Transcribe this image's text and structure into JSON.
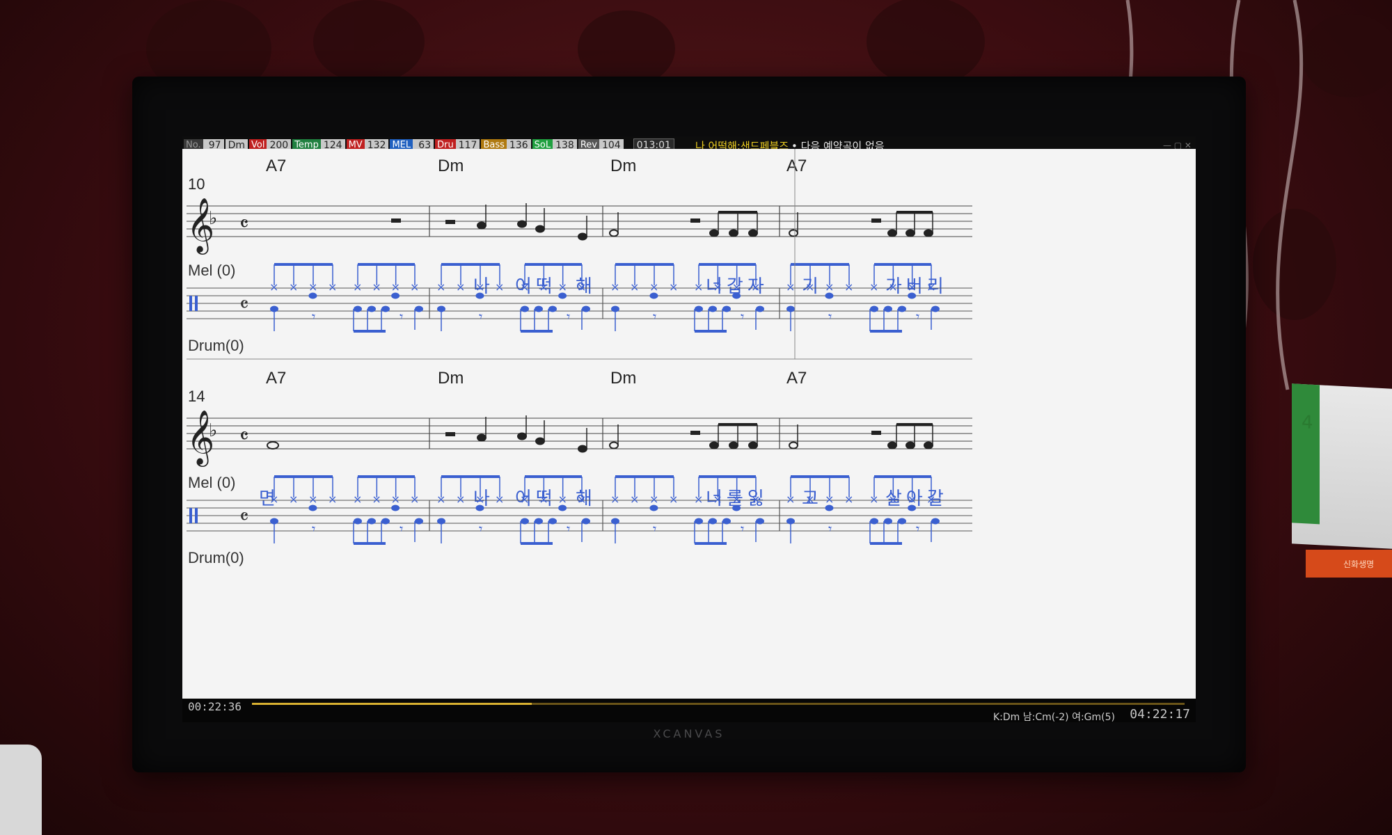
{
  "statusbar": {
    "items": [
      {
        "label": "No.",
        "value": "97",
        "label_color": "#9a9a9a",
        "label_bg": "#3a3a3a"
      },
      {
        "label": "",
        "value": "Dm",
        "label_color": "#9a9a9a",
        "label_bg": "#3a3a3a"
      },
      {
        "label": "Vol",
        "value": "200",
        "label_color": "#ffffff",
        "label_bg": "#c02020"
      },
      {
        "label": "Temp",
        "value": "124",
        "label_color": "#ffffff",
        "label_bg": "#208040"
      },
      {
        "label": "MV",
        "value": "132",
        "label_color": "#ffffff",
        "label_bg": "#c02020"
      },
      {
        "label": "MEL",
        "value": "63",
        "label_color": "#ffffff",
        "label_bg": "#2060c0"
      },
      {
        "label": "Dru",
        "value": "117",
        "label_color": "#ffffff",
        "label_bg": "#c02020"
      },
      {
        "label": "Bass",
        "value": "136",
        "label_color": "#ffffff",
        "label_bg": "#b07a10"
      },
      {
        "label": "SoL",
        "value": "138",
        "label_color": "#ffffff",
        "label_bg": "#20a040"
      },
      {
        "label": "Rev",
        "value": "104",
        "label_color": "#ffffff",
        "label_bg": "#555555"
      }
    ],
    "position": "013:01",
    "song_title": "나 어떡해:샌드페블즈",
    "next_song": "• 다음 예약곡이 없음"
  },
  "score": {
    "systems": [
      {
        "measure_number": "10",
        "chords": [
          "A7",
          "Dm",
          "Dm",
          "A7"
        ],
        "mel_label": "Mel (0)",
        "drum_label": "Drum(0)",
        "lyrics": [
          "",
          "나",
          "어떡",
          "해",
          "너갑자",
          "기",
          "가버리"
        ]
      },
      {
        "measure_number": "14",
        "chords": [
          "A7",
          "Dm",
          "Dm",
          "A7"
        ],
        "mel_label": "Mel (0)",
        "drum_label": "Drum(0)",
        "lyrics": [
          "면",
          "나",
          "어떡",
          "해",
          "너를잃",
          "고",
          "살아갈"
        ]
      }
    ]
  },
  "bottombar": {
    "elapsed": "00:22:36",
    "progress": 0.3,
    "key_info": "K:Dm 남:Cm(-2) 여:Gm(5)",
    "clock": "04:22:17"
  },
  "monitor": {
    "brand": "XCANVAS"
  },
  "desk": {
    "calendar_number": "4",
    "box_label": "신화생명"
  },
  "colors": {
    "notation_blue": "#3a5fd0",
    "lyric_blue": "#3a5fd0",
    "paper": "#f4f4f4"
  },
  "icons": [
    "treble-clef-icon",
    "flat-icon",
    "common-time-icon",
    "percussion-clef-icon"
  ]
}
